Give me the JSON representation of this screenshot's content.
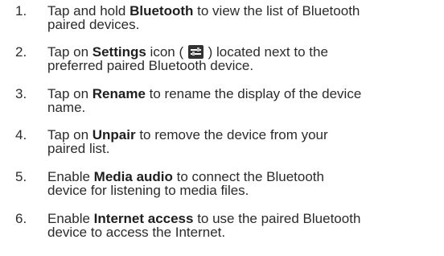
{
  "steps": [
    {
      "number": "1.",
      "prefix": "Tap and hold ",
      "bold": "Bluetooth",
      "suffix": " to view the list of Bluetooth",
      "line2": "paired devices."
    },
    {
      "number": "2.",
      "prefix": "Tap on ",
      "bold": "Settings",
      "icon_open": " icon ( ",
      "icon": "settings-sliders-icon",
      "icon_close": " ) located next to the",
      "line2": "preferred paired Bluetooth device."
    },
    {
      "number": "3.",
      "prefix": "Tap on ",
      "bold": "Rename",
      "suffix": " to rename the display of the device",
      "line2": "name."
    },
    {
      "number": "4.",
      "prefix": "Tap on ",
      "bold": "Unpair",
      "suffix": " to remove the device from your",
      "line2": "paired list."
    },
    {
      "number": "5.",
      "prefix": "Enable ",
      "bold": "Media audio",
      "suffix": " to connect the Bluetooth",
      "line2": "device for listening to media files."
    },
    {
      "number": "6.",
      "prefix": "Enable ",
      "bold": "Internet access",
      "suffix": " to use the paired Bluetooth",
      "line2": "device to access the Internet."
    }
  ]
}
